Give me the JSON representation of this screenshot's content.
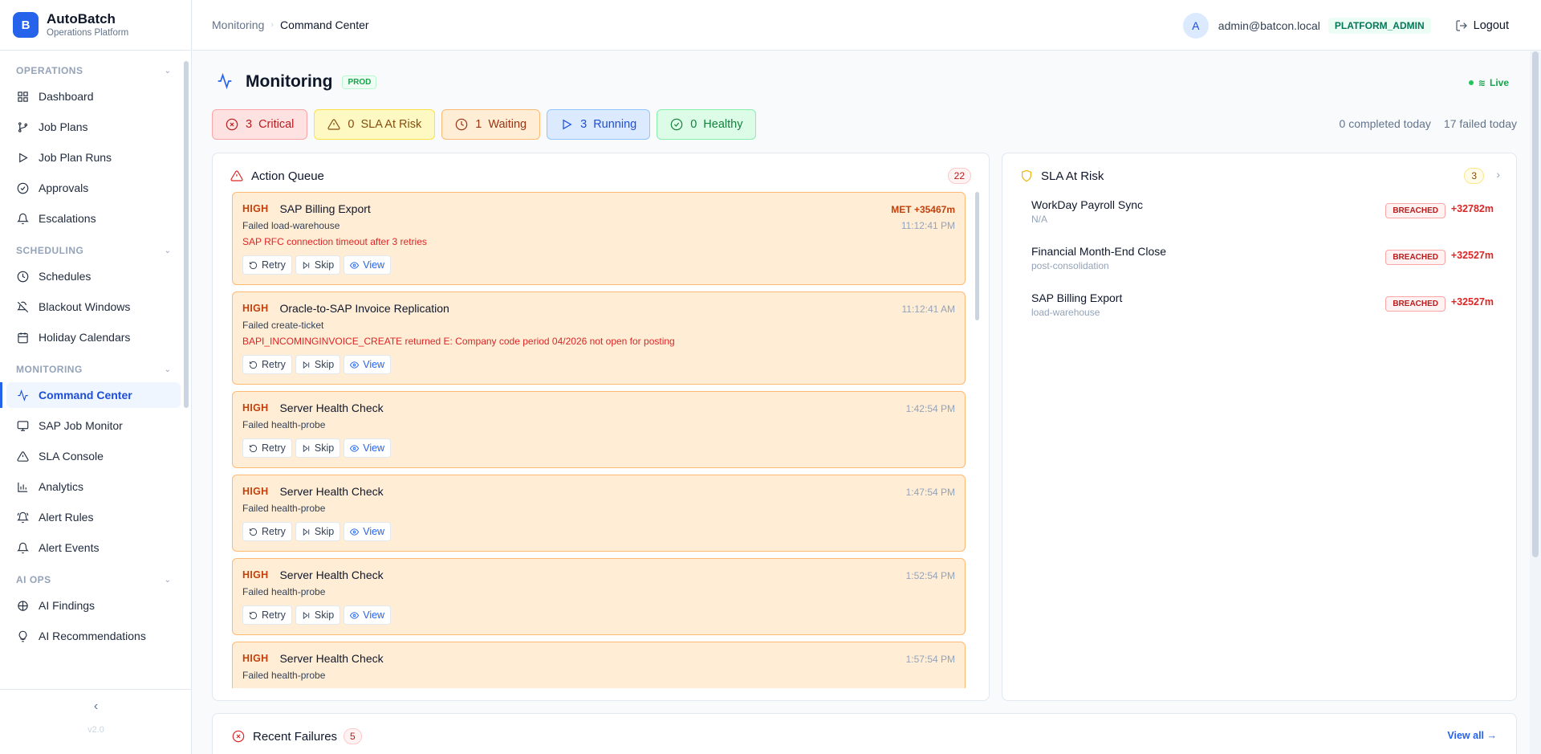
{
  "brand": {
    "logo_letter": "B",
    "name": "AutoBatch",
    "subtitle": "Operations Platform"
  },
  "sidebar": {
    "sections": [
      {
        "label": "OPERATIONS",
        "items": [
          {
            "label": "Dashboard",
            "icon": "grid-icon"
          },
          {
            "label": "Job Plans",
            "icon": "branch-icon"
          },
          {
            "label": "Job Plan Runs",
            "icon": "play-icon"
          },
          {
            "label": "Approvals",
            "icon": "check-circle-icon"
          },
          {
            "label": "Escalations",
            "icon": "bell-icon"
          }
        ]
      },
      {
        "label": "SCHEDULING",
        "items": [
          {
            "label": "Schedules",
            "icon": "clock-icon"
          },
          {
            "label": "Blackout Windows",
            "icon": "bell-off-icon"
          },
          {
            "label": "Holiday Calendars",
            "icon": "calendar-icon"
          }
        ]
      },
      {
        "label": "MONITORING",
        "items": [
          {
            "label": "Command Center",
            "icon": "activity-icon",
            "active": true
          },
          {
            "label": "SAP Job Monitor",
            "icon": "monitor-icon"
          },
          {
            "label": "SLA Console",
            "icon": "alert-triangle-icon"
          },
          {
            "label": "Analytics",
            "icon": "bar-chart-icon"
          },
          {
            "label": "Alert Rules",
            "icon": "bell-ring-icon"
          },
          {
            "label": "Alert Events",
            "icon": "bell-icon"
          }
        ]
      },
      {
        "label": "AI OPS",
        "items": [
          {
            "label": "AI Findings",
            "icon": "brain-icon"
          },
          {
            "label": "AI Recommendations",
            "icon": "lightbulb-icon"
          }
        ]
      }
    ],
    "collapse_glyph": "‹",
    "version": "v2.0"
  },
  "header": {
    "breadcrumb": [
      "Monitoring",
      "Command Center"
    ],
    "avatar_letter": "A",
    "user_email": "admin@batcon.local",
    "role": "PLATFORM_ADMIN",
    "logout_label": "Logout"
  },
  "page": {
    "title": "Monitoring",
    "env": "PROD",
    "live_label": "Live",
    "completed_today": "0 completed today",
    "failed_today": "17 failed today"
  },
  "status_pills": [
    {
      "key": "critical",
      "count": "3",
      "label": "Critical"
    },
    {
      "key": "sla",
      "count": "0",
      "label": "SLA At Risk"
    },
    {
      "key": "waiting",
      "count": "1",
      "label": "Waiting"
    },
    {
      "key": "running",
      "count": "3",
      "label": "Running"
    },
    {
      "key": "healthy",
      "count": "0",
      "label": "Healthy"
    }
  ],
  "action_queue": {
    "title": "Action Queue",
    "count": "22",
    "retry_label": "Retry",
    "skip_label": "Skip",
    "view_label": "View",
    "items": [
      {
        "severity": "HIGH",
        "name": "SAP Billing Export",
        "met": "MET +35467m",
        "time": "11:12:41 PM",
        "status": "Failed load-warehouse",
        "error": "SAP RFC connection timeout after 3 retries"
      },
      {
        "severity": "HIGH",
        "name": "Oracle-to-SAP Invoice Replication",
        "met": "",
        "time": "11:12:41 AM",
        "status": "Failed create-ticket",
        "error": "BAPI_INCOMINGINVOICE_CREATE returned E: Company code period 04/2026 not open for posting"
      },
      {
        "severity": "HIGH",
        "name": "Server Health Check",
        "met": "",
        "time": "1:42:54 PM",
        "status": "Failed health-probe",
        "error": ""
      },
      {
        "severity": "HIGH",
        "name": "Server Health Check",
        "met": "",
        "time": "1:47:54 PM",
        "status": "Failed health-probe",
        "error": ""
      },
      {
        "severity": "HIGH",
        "name": "Server Health Check",
        "met": "",
        "time": "1:52:54 PM",
        "status": "Failed health-probe",
        "error": ""
      },
      {
        "severity": "HIGH",
        "name": "Server Health Check",
        "met": "",
        "time": "1:57:54 PM",
        "status": "Failed health-probe",
        "error": ""
      }
    ]
  },
  "sla_at_risk": {
    "title": "SLA At Risk",
    "count": "3",
    "items": [
      {
        "name": "WorkDay Payroll Sync",
        "step": "N/A",
        "status": "BREACHED",
        "overdue": "+32782m"
      },
      {
        "name": "Financial Month-End Close",
        "step": "post-consolidation",
        "status": "BREACHED",
        "overdue": "+32527m"
      },
      {
        "name": "SAP Billing Export",
        "step": "load-warehouse",
        "status": "BREACHED",
        "overdue": "+32527m"
      }
    ]
  },
  "recent_failures": {
    "title": "Recent Failures",
    "count": "5",
    "view_all": "View all →"
  }
}
